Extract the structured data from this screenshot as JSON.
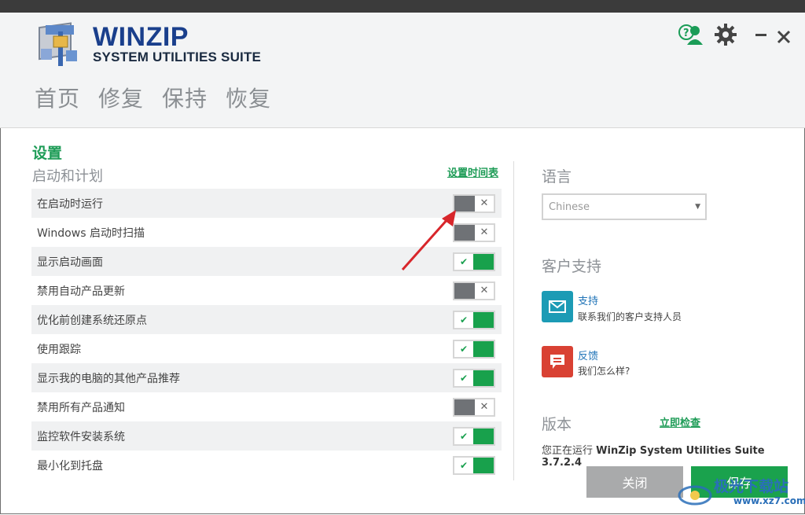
{
  "app": {
    "logo_line1": "WINZIP",
    "logo_line2": "SYSTEM UTILITIES SUITE"
  },
  "nav": [
    {
      "label": "首页"
    },
    {
      "label": "修复"
    },
    {
      "label": "保持"
    },
    {
      "label": "恢复"
    }
  ],
  "settings": {
    "title": "设置",
    "startup_title": "启动和计划",
    "schedule_link": "设置时间表",
    "rows": [
      {
        "label": "在启动时运行",
        "enabled": false
      },
      {
        "label": "Windows 启动时扫描",
        "enabled": false
      },
      {
        "label": "显示启动画面",
        "enabled": true
      },
      {
        "label": "禁用自动产品更新",
        "enabled": false
      },
      {
        "label": "优化前创建系统还原点",
        "enabled": true
      },
      {
        "label": "使用跟踪",
        "enabled": true
      },
      {
        "label": "显示我的电脑的其他产品推荐",
        "enabled": true
      },
      {
        "label": "禁用所有产品通知",
        "enabled": false
      },
      {
        "label": "监控软件安装系统",
        "enabled": true
      },
      {
        "label": "最小化到托盘",
        "enabled": true
      }
    ]
  },
  "language": {
    "title": "语言",
    "selected": "Chinese"
  },
  "support": {
    "title": "客户支持",
    "contact_label": "支持",
    "contact_desc": "联系我们的客户支持人员",
    "feedback_label": "反馈",
    "feedback_desc": "我们怎么样?"
  },
  "version": {
    "title": "版本",
    "check_link": "立即检查",
    "running_prefix": "您正在运行",
    "product_version": "WinZip System Utilities Suite 3.7.2.4"
  },
  "buttons": {
    "close": "关闭",
    "save": "保存"
  },
  "watermark": {
    "line1": "极光下载站",
    "line2": "www.xz7.com"
  },
  "colors": {
    "accent_green": "#1aa24d",
    "link_blue": "#1f73b7",
    "support_teal": "#1c9bb5",
    "feedback_red": "#d94133"
  }
}
